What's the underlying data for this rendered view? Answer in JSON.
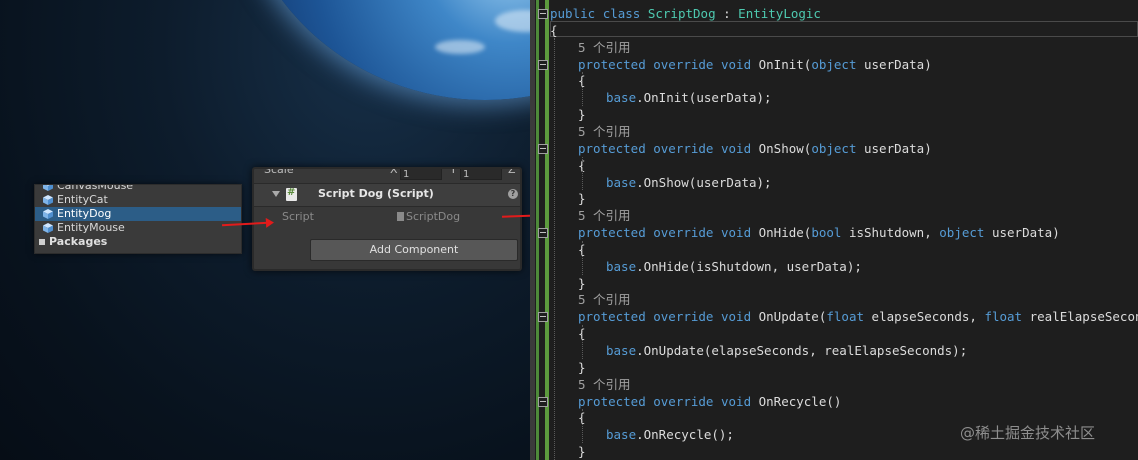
{
  "hierarchy": {
    "items": [
      {
        "label": "CanvasMouse",
        "selected": false
      },
      {
        "label": "EntityCat",
        "selected": false
      },
      {
        "label": "EntityDog",
        "selected": true
      },
      {
        "label": "EntityMouse",
        "selected": false
      }
    ],
    "packages_label": "Packages"
  },
  "inspector": {
    "scale_label": "Scale",
    "scale_axis_x": "X",
    "scale_value_x": "1",
    "scale_axis_y": "Y",
    "scale_value_y": "1",
    "scale_axis_z": "Z",
    "component_title": "Script Dog (Script)",
    "field_label": "Script",
    "field_value": "ScriptDog",
    "add_component_label": "Add Component"
  },
  "code": {
    "class_decl": {
      "kw1": "public",
      "kw2": "class",
      "name": "ScriptDog",
      "sep": " : ",
      "base": "EntityLogic"
    },
    "open_brace": "{",
    "methods": [
      {
        "ref": "5 个引用",
        "mods": "protected override void",
        "name": "OnInit",
        "params_before": "(",
        "params": [
          {
            "type": "object",
            "name": "userData"
          }
        ],
        "params_after": ")",
        "body": "base.OnInit(userData);"
      },
      {
        "ref": "5 个引用",
        "mods": "protected override void",
        "name": "OnShow",
        "params_before": "(",
        "params": [
          {
            "type": "object",
            "name": "userData"
          }
        ],
        "params_after": ")",
        "body": "base.OnShow(userData);"
      },
      {
        "ref": "5 个引用",
        "mods": "protected override void",
        "name": "OnHide",
        "params_before": "(",
        "params": [
          {
            "type": "bool",
            "name": "isShutdown"
          },
          {
            "type": "object",
            "name": "userData"
          }
        ],
        "params_after": ")",
        "body": "base.OnHide(isShutdown, userData);"
      },
      {
        "ref": "5 个引用",
        "mods": "protected override void",
        "name": "OnUpdate",
        "params_before": "(",
        "params": [
          {
            "type": "float",
            "name": "elapseSeconds"
          },
          {
            "type": "float",
            "name": "realElapseSeconds"
          }
        ],
        "params_after": ")",
        "body": "base.OnUpdate(elapseSeconds, realElapseSeconds);"
      },
      {
        "ref": "5 个引用",
        "mods": "protected override void",
        "name": "OnRecycle",
        "params_before": "()",
        "params": [],
        "params_after": "",
        "body": "base.OnRecycle();"
      }
    ],
    "brace_open": "{",
    "brace_close": "}"
  },
  "watermark": "@稀土掘金技术社区",
  "colors": {
    "keyword": "#569cd6",
    "type": "#4ec9b0",
    "arrow": "#e21b1b",
    "selection": "#2c5d87"
  }
}
